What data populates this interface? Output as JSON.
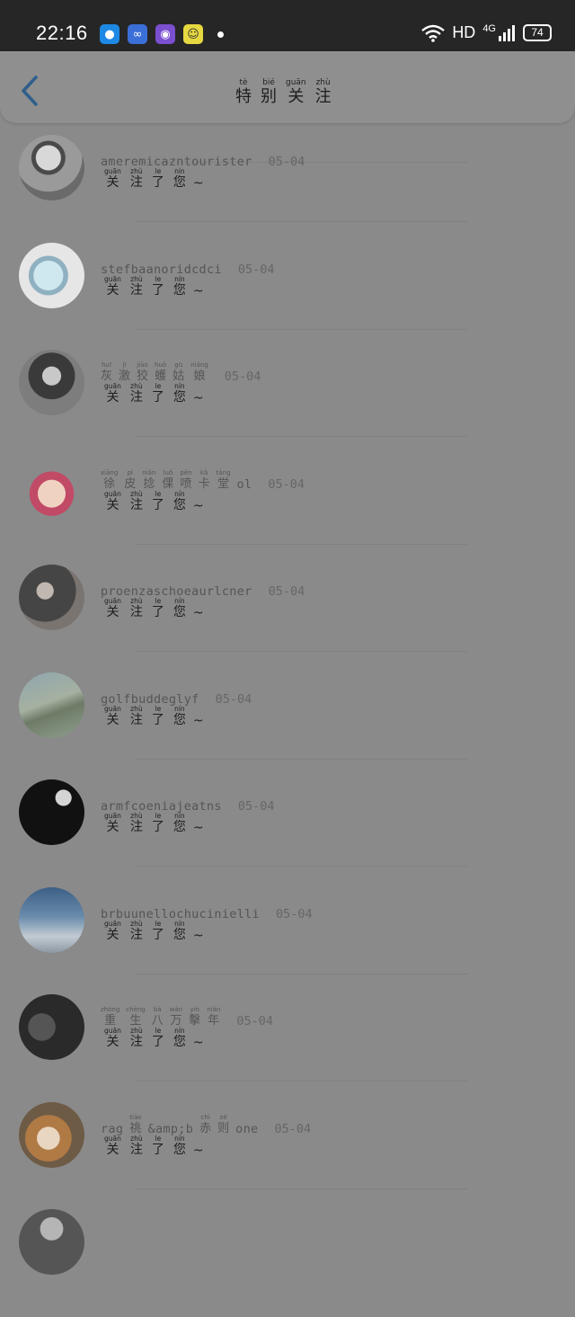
{
  "status_bar": {
    "time": "22:16",
    "network": "HD",
    "signal": "4G",
    "battery": "74"
  },
  "header": {
    "title": [
      {
        "py": "tè",
        "hz": "特"
      },
      {
        "py": "bié",
        "hz": "别"
      },
      {
        "py": "guān",
        "hz": "关"
      },
      {
        "py": "zhù",
        "hz": "注"
      }
    ]
  },
  "message": [
    {
      "py": "guān",
      "hz": "关"
    },
    {
      "py": "zhù",
      "hz": "注"
    },
    {
      "py": "le",
      "hz": "了"
    },
    {
      "py": "nín",
      "hz": "您"
    }
  ],
  "message_suffix": "~",
  "rows": [
    {
      "name": "ameremicazntourister",
      "date": "05-04"
    },
    {
      "name": "stefbaanoridcdci",
      "date": "05-04"
    },
    {
      "name_cn": [
        {
          "py": "huī",
          "hz": "灰"
        },
        {
          "py": "jī",
          "hz": "激"
        },
        {
          "py": "jiāo",
          "hz": "狡"
        },
        {
          "py": "huò",
          "hz": "蠖"
        },
        {
          "py": "gū",
          "hz": "姑"
        },
        {
          "py": "niáng",
          "hz": "娘"
        }
      ],
      "date": "05-04"
    },
    {
      "name_cn": [
        {
          "py": "xiāng",
          "hz": "徐"
        },
        {
          "py": "pí",
          "hz": "皮"
        },
        {
          "py": "niǎn",
          "hz": "捻"
        },
        {
          "py": "luǒ",
          "hz": "倮"
        },
        {
          "py": "pēn",
          "hz": "喷"
        },
        {
          "py": "kǎ",
          "hz": "卡"
        },
        {
          "py": "táng",
          "hz": "堂"
        }
      ],
      "name_suffix": "ol",
      "date": "05-04"
    },
    {
      "name": "proenzaschoeaurlcner",
      "date": "05-04"
    },
    {
      "name": "golfbuddeglyf",
      "date": "05-04"
    },
    {
      "name": "armfcoeniajeatns",
      "date": "05-04"
    },
    {
      "name": "brbuunellochucinielli",
      "date": "05-04"
    },
    {
      "name_cn": [
        {
          "py": "zhòng",
          "hz": "重"
        },
        {
          "py": "chēng",
          "hz": "生"
        },
        {
          "py": "bā",
          "hz": "八"
        },
        {
          "py": "wàn",
          "hz": "万"
        },
        {
          "py": "yín",
          "hz": "擊"
        },
        {
          "py": "nián",
          "hz": "年"
        }
      ],
      "date": "05-04"
    },
    {
      "name_mixed": [
        "rag",
        {
          "py": "tiāo",
          "hz": "祧"
        },
        "&amp;b",
        {
          "py": "chì",
          "hz": "赤"
        },
        {
          "py": "zé",
          "hz": "则"
        },
        "one"
      ],
      "date": "05-04"
    }
  ],
  "colors": {
    "overlay_bg": "#8a8a8a",
    "status_bar": "#262626",
    "back_arrow": "#2f5e8c"
  }
}
